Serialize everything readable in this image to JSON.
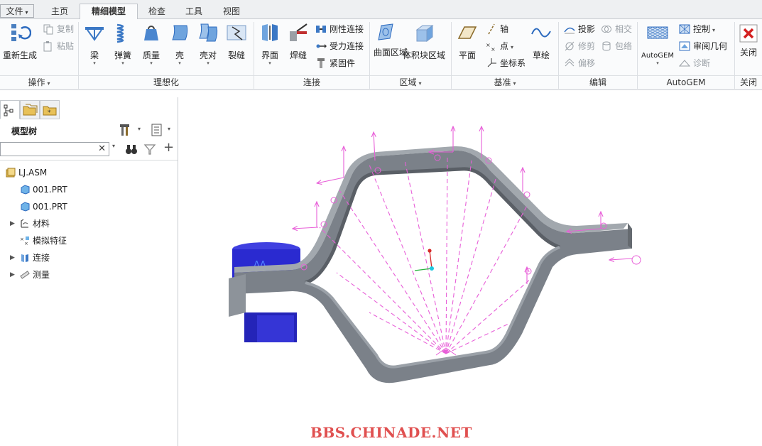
{
  "tabs": {
    "file": "文件",
    "items": [
      "主页",
      "精细模型",
      "检查",
      "工具",
      "视图"
    ],
    "active": "精细模型"
  },
  "ribbon": {
    "ops": {
      "regenerate": "重新生成",
      "copy": "复制",
      "paste": "粘贴",
      "group": "操作"
    },
    "ideal": {
      "beam": "梁",
      "spring": "弹簧",
      "mass": "质量",
      "shell": "壳",
      "shell_pair": "壳对",
      "crack": "裂缝",
      "group": "理想化"
    },
    "connect": {
      "interface": "界面",
      "weld": "焊缝",
      "rigid_link": "刚性连接",
      "force_link": "受力连接",
      "fastener": "紧固件",
      "group": "连接"
    },
    "region": {
      "surface_region": "曲面区域",
      "volume_region": "体积块区域",
      "group": "区域"
    },
    "datum": {
      "plane": "平面",
      "axis": "轴",
      "point": "点",
      "csys": "坐标系",
      "sketch": "草绘",
      "group": "基准"
    },
    "edit": {
      "project": "投影",
      "intersect": "相交",
      "trim": "修剪",
      "wrap": "包络",
      "offset": "偏移",
      "group": "编辑"
    },
    "autogem": {
      "autogem": "AutoGEM",
      "control": "控制",
      "review_geometry": "审阅几何",
      "diagnose": "诊断",
      "group": "AutoGEM"
    },
    "close": {
      "close": "关闭",
      "group": "关闭"
    }
  },
  "model_tree": {
    "title": "模型树",
    "search_value": "",
    "nodes": [
      {
        "label": "LJ.ASM",
        "level": 0,
        "expand": false
      },
      {
        "label": "001.PRT",
        "level": 1,
        "expand": false
      },
      {
        "label": "001.PRT",
        "level": 1,
        "expand": false
      },
      {
        "label": "材料",
        "level": 1,
        "expand": true
      },
      {
        "label": "模拟特征",
        "level": 1,
        "expand": false
      },
      {
        "label": "连接",
        "level": 1,
        "expand": true
      },
      {
        "label": "测量",
        "level": 1,
        "expand": true
      }
    ]
  },
  "watermark": "BBS.CHINADE.NET",
  "colors": {
    "accent": "#1e6fc4",
    "part_gray": "#7b8189",
    "bolt_blue": "#2a2ad0",
    "load_magenta": "#e85fd8"
  }
}
